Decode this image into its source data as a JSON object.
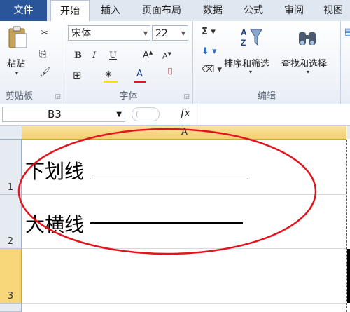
{
  "tabs": [
    "文件",
    "开始",
    "插入",
    "页面布局",
    "数据",
    "公式",
    "审阅",
    "视图"
  ],
  "clipboard": {
    "paste_label": "粘贴",
    "group_label": "剪贴板"
  },
  "font": {
    "name": "宋体",
    "size": "22",
    "group_label": "字体"
  },
  "editing": {
    "sort_label": "排序和筛选",
    "find_label": "查找和选择",
    "group_label": "编辑"
  },
  "formula_bar": {
    "name_box": "B3",
    "fx": "fx"
  },
  "sheet": {
    "column": "A",
    "rows": [
      {
        "number": "1",
        "text": "下划线"
      },
      {
        "number": "2",
        "text": "大横线"
      },
      {
        "number": "3",
        "text": ""
      }
    ]
  },
  "colors": {
    "annotation": "#e3141b",
    "file_tab": "#2a5699",
    "selected_header": "#f3cf6c"
  }
}
